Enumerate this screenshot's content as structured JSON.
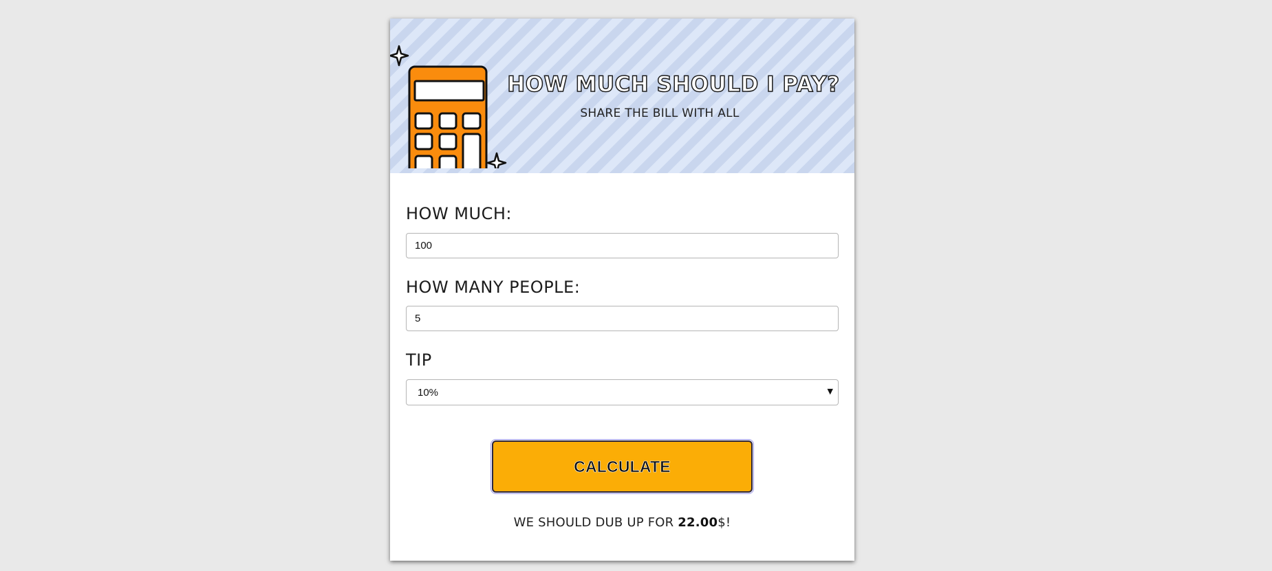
{
  "header": {
    "title": "HOW MUCH SHOULD I PAY?",
    "subtitle": "SHARE THE BILL WITH ALL",
    "icon": "calculator-icon"
  },
  "form": {
    "amount_label": "HOW MUCH:",
    "amount_value": "100",
    "people_label": "HOW MANY PEOPLE:",
    "people_value": "5",
    "tip_label": "TIP",
    "tip_selected": "10%"
  },
  "button": {
    "label": "CALCULATE"
  },
  "result": {
    "prefix": "WE SHOULD DUB UP FOR ",
    "amount": "22.00",
    "suffix": "$!"
  },
  "colors": {
    "page_background": "#e9e9e9",
    "stripe_dark": "#c9d6ee",
    "stripe_light": "#dde7f8",
    "button": "#fbad06",
    "calculator_body": "#fa8c0d"
  }
}
